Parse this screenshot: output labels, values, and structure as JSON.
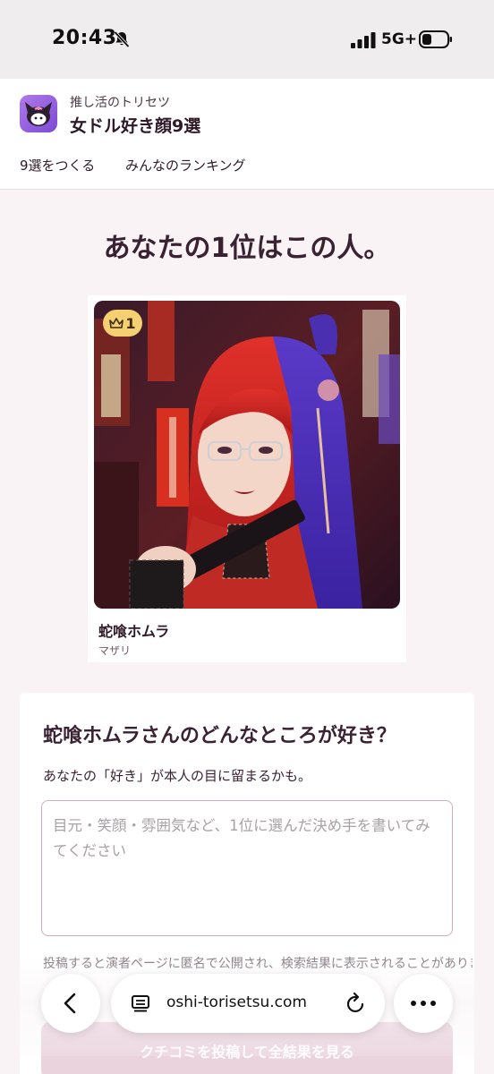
{
  "status_bar": {
    "time": "20:43",
    "network": "5G+"
  },
  "header": {
    "subtitle": "推し活のトリセツ",
    "title": "女ドル好き顔9選",
    "tabs": [
      {
        "label": "9選をつくる"
      },
      {
        "label": "みんなのランキング"
      }
    ]
  },
  "result": {
    "heading": "あなたの1位はこの人。",
    "rank": "1",
    "member_name": "蛇喰ホムラ",
    "group_name": "マザリ"
  },
  "comment": {
    "question": "蛇喰ホムラさんのどんなところが好き？",
    "hint": "あなたの「好き」が本人の目に留まるかも。",
    "placeholder": "目元・笑顔・雰囲気など、1位に選んだ決め手を書いてみてください",
    "notice": "投稿すると演者ページに匿名で公開され、検索結果に表示されることがあります",
    "submit_label": "クチコミを投稿して全結果を見る"
  },
  "browser": {
    "url": "oshi-torisetsu.com"
  },
  "colors": {
    "accent": "#d8a9c0",
    "badge": "#f4d070",
    "submit_disabled": "#ead3dd"
  }
}
